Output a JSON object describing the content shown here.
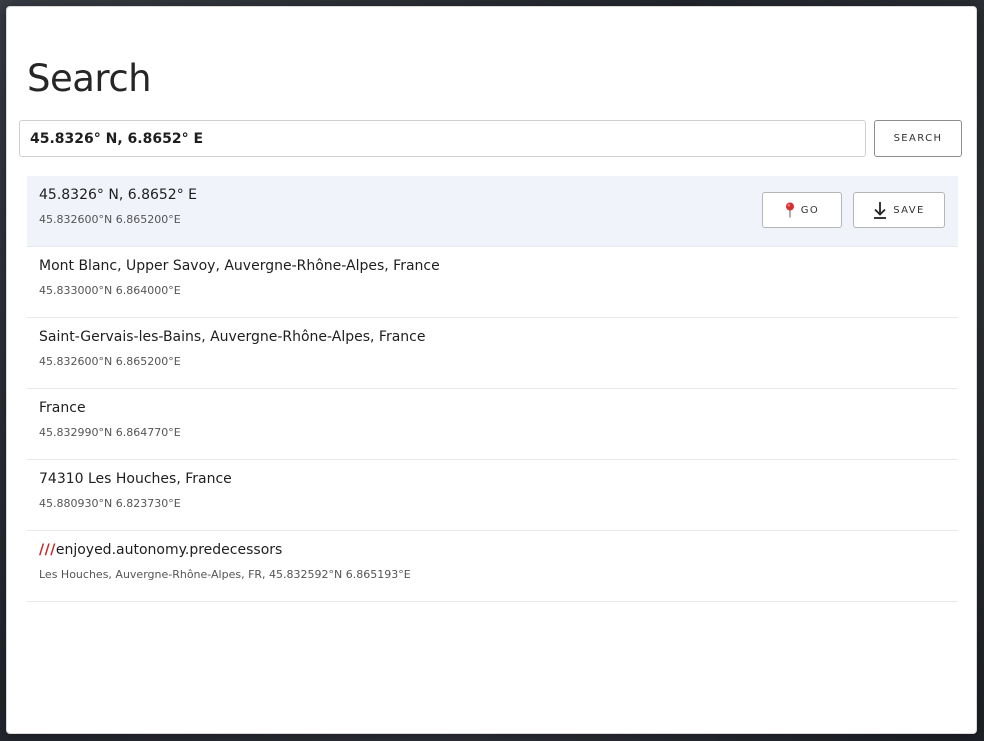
{
  "search": {
    "title": "Search",
    "query": "45.8326° N, 6.8652° E",
    "button_label": "SEARCH"
  },
  "results": [
    {
      "name": "45.8326° N, 6.8652° E",
      "coords": "45.832600°N 6.865200°E",
      "selected": true
    },
    {
      "name": "Mont Blanc, Upper Savoy, Auvergne-Rhône-Alpes, France",
      "coords": "45.833000°N 6.864000°E"
    },
    {
      "name": "Saint-Gervais-les-Bains, Auvergne-Rhône-Alpes, France",
      "coords": "45.832600°N 6.865200°E"
    },
    {
      "name": "France",
      "coords": "45.832990°N 6.864770°E"
    },
    {
      "name": "74310 Les Houches, France",
      "coords": "45.880930°N 6.823730°E"
    },
    {
      "prefix": "///",
      "name": "enjoyed.autonomy.predecessors",
      "coords": "Les Houches, Auvergne-Rhône-Alpes, FR, 45.832592°N 6.865193°E"
    }
  ],
  "actions": {
    "go_label": "GO",
    "save_label": "SAVE"
  },
  "icons": {
    "go": "map-pin-icon",
    "save": "download-icon"
  },
  "colors": {
    "selected_row": "#f1f3fa",
    "pin": "#d32f2f",
    "what3words_slashes": "#c62828"
  }
}
